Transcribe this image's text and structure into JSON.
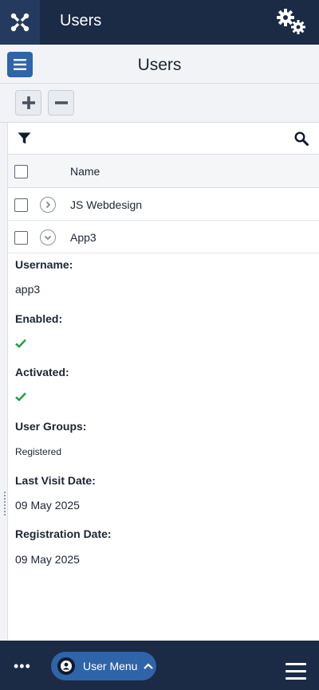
{
  "header": {
    "app_title": "Users"
  },
  "subheader": {
    "page_title": "Users"
  },
  "table": {
    "column_name": "Name",
    "rows": [
      {
        "name": "JS Webdesign",
        "expanded": false
      },
      {
        "name": "App3",
        "expanded": true
      }
    ]
  },
  "details": {
    "username_label": "Username:",
    "username_value": "app3",
    "enabled_label": "Enabled:",
    "activated_label": "Activated:",
    "groups_label": "User Groups:",
    "groups_value": "Registered",
    "last_visit_label": "Last Visit Date:",
    "last_visit_value": "09 May 2025",
    "registration_label": "Registration Date:",
    "registration_value": "09 May 2025"
  },
  "footer": {
    "more_label": "•••",
    "user_menu_label": "User Menu"
  },
  "colors": {
    "header_bg": "#1b2a45",
    "accent": "#2f64a8",
    "check_green": "#27a04a"
  },
  "icons": [
    "joomla-logo-icon",
    "gears-icon",
    "sidebar-toggle-icon",
    "plus-icon",
    "minus-icon",
    "filter-icon",
    "search-icon",
    "chevron-right-circle-icon",
    "chevron-down-circle-icon",
    "checkmark-icon",
    "user-avatar-icon",
    "chevron-up-icon",
    "hamburger-icon"
  ]
}
